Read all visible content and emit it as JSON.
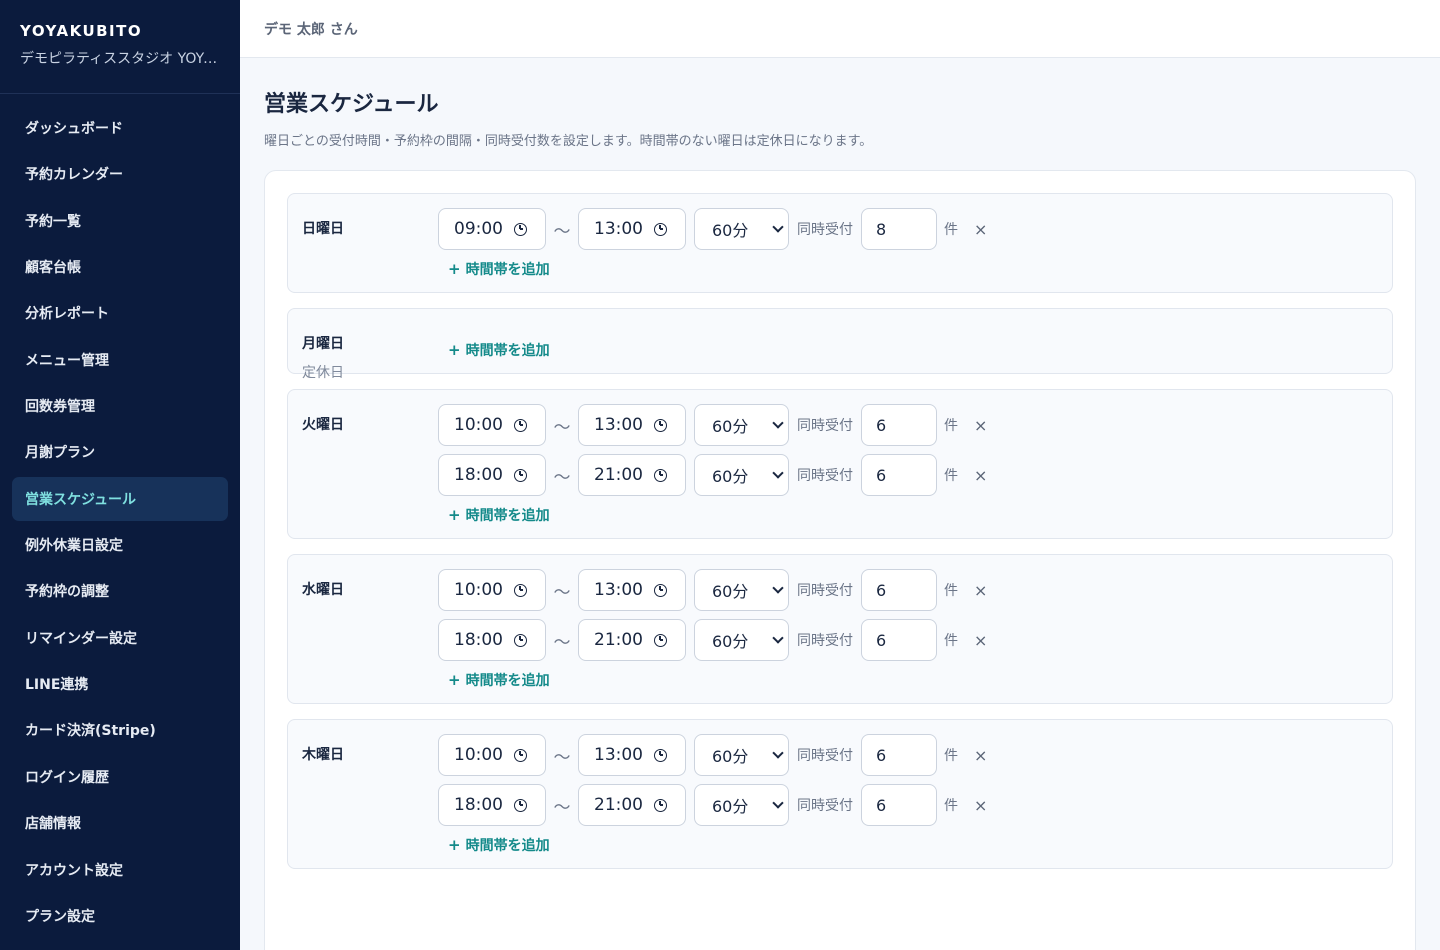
{
  "sidebar": {
    "brand": "YOYAKUBITO",
    "store": "デモピラティススタジオ YOYAKUBITO",
    "items": [
      {
        "label": "ダッシュボード"
      },
      {
        "label": "予約カレンダー"
      },
      {
        "label": "予約一覧"
      },
      {
        "label": "顧客台帳"
      },
      {
        "label": "分析レポート"
      },
      {
        "label": "メニュー管理"
      },
      {
        "label": "回数券管理"
      },
      {
        "label": "月謝プラン"
      },
      {
        "label": "営業スケジュール",
        "active": true
      },
      {
        "label": "例外休業日設定"
      },
      {
        "label": "予約枠の調整"
      },
      {
        "label": "リマインダー設定"
      },
      {
        "label": "LINE連携"
      },
      {
        "label": "カード決済(Stripe)"
      },
      {
        "label": "ログイン履歴"
      },
      {
        "label": "店舗情報"
      },
      {
        "label": "アカウント設定"
      },
      {
        "label": "プラン設定"
      }
    ]
  },
  "header": {
    "user": "デモ 太郎 さん"
  },
  "page": {
    "title": "営業スケジュール",
    "description": "曜日ごとの受付時間・予約枠の間隔・同時受付数を設定します。時間帯のない曜日は定休日になります。"
  },
  "labels": {
    "tilde": "〜",
    "capacity": "同時受付",
    "unit": "件",
    "remove": "×",
    "add_slot": "時間帯を追加",
    "add_plus": "+"
  },
  "days": [
    {
      "name": "日曜日",
      "note": "",
      "slots": [
        {
          "start": "09:00",
          "end": "13:00",
          "interval": "60分",
          "capacity": "8"
        }
      ]
    },
    {
      "name": "月曜日",
      "note": "定休日",
      "slots": []
    },
    {
      "name": "火曜日",
      "note": "",
      "slots": [
        {
          "start": "10:00",
          "end": "13:00",
          "interval": "60分",
          "capacity": "6"
        },
        {
          "start": "18:00",
          "end": "21:00",
          "interval": "60分",
          "capacity": "6"
        }
      ]
    },
    {
      "name": "水曜日",
      "note": "",
      "slots": [
        {
          "start": "10:00",
          "end": "13:00",
          "interval": "60分",
          "capacity": "6"
        },
        {
          "start": "18:00",
          "end": "21:00",
          "interval": "60分",
          "capacity": "6"
        }
      ]
    },
    {
      "name": "木曜日",
      "note": "",
      "slots": [
        {
          "start": "10:00",
          "end": "13:00",
          "interval": "60分",
          "capacity": "6"
        },
        {
          "start": "18:00",
          "end": "21:00",
          "interval": "60分",
          "capacity": "6"
        }
      ]
    }
  ]
}
